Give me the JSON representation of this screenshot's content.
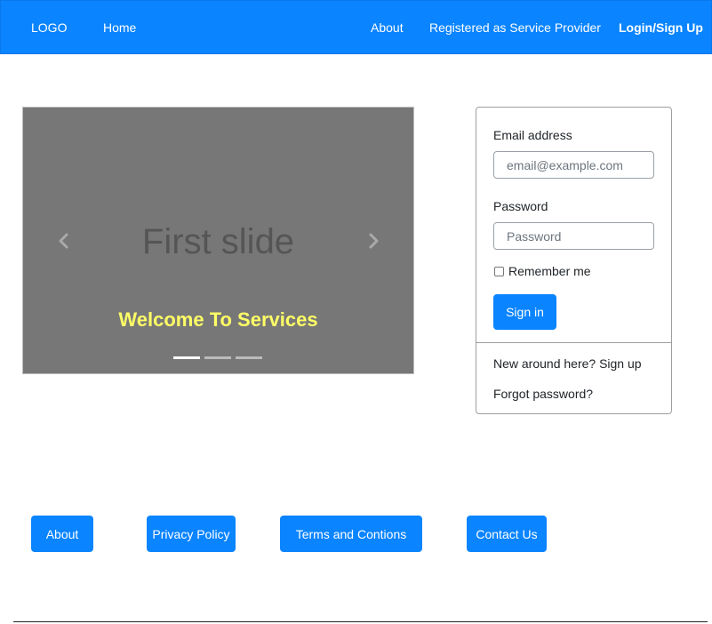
{
  "nav": {
    "logo": "LOGO",
    "home": "Home",
    "about": "About",
    "service_provider": "Registered as Service Provider",
    "login": "Login/Sign Up"
  },
  "carousel": {
    "slide_text": "First slide",
    "caption": "Welcome To Services",
    "prev_icon": "chevron-left-icon",
    "next_icon": "chevron-right-icon",
    "indicator_count": 3,
    "active_indicator": 1
  },
  "login": {
    "email_label": "Email address",
    "email_placeholder": "email@example.com",
    "password_label": "Password",
    "password_placeholder": "Password",
    "remember_label": "Remember me",
    "signin_label": "Sign in",
    "signup_link": "New around here? Sign up",
    "forgot_link": "Forgot password?"
  },
  "footer": {
    "about": "About",
    "privacy": "Privacy Policy",
    "terms": "Terms and Contions",
    "contact": "Contact Us"
  },
  "colors": {
    "primary": "#0a84ff",
    "slide_bg": "#777777",
    "caption": "#ffff66"
  }
}
